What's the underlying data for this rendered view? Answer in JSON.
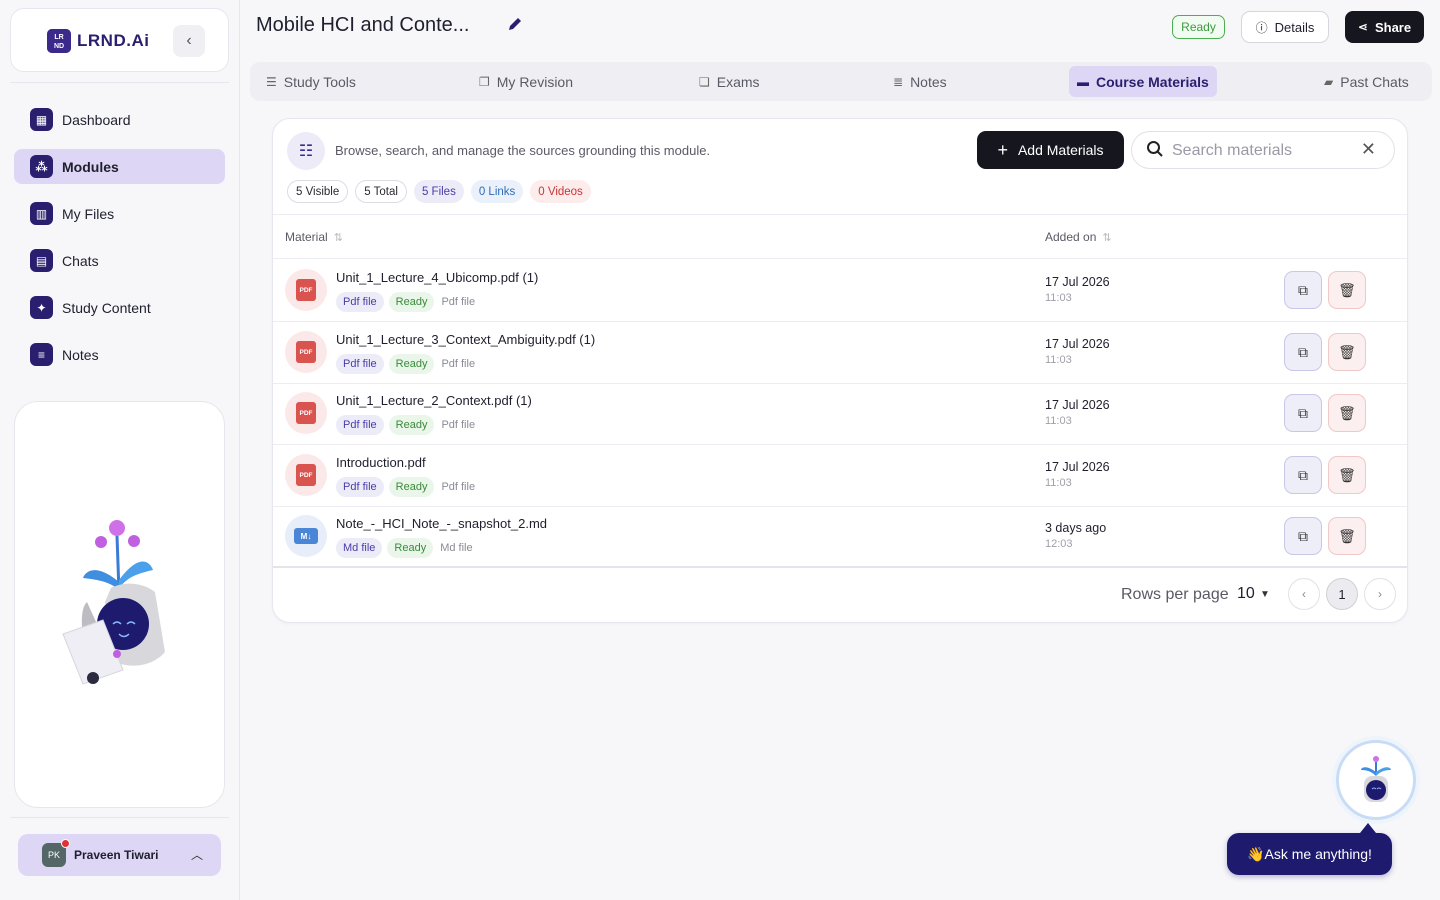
{
  "brand": {
    "logo_mark": "LR ND",
    "name": "LRND.Ai"
  },
  "sidebar": {
    "collapse_icon": "chevron-left-icon",
    "items": [
      {
        "label": "Dashboard",
        "icon": "dashboard-icon",
        "active": false
      },
      {
        "label": "Modules",
        "icon": "modules-icon",
        "active": true
      },
      {
        "label": "My Files",
        "icon": "files-icon",
        "active": false
      },
      {
        "label": "Chats",
        "icon": "chat-icon",
        "active": false
      },
      {
        "label": "Study Content",
        "icon": "sparkle-icon",
        "active": false
      },
      {
        "label": "Notes",
        "icon": "notes-icon",
        "active": false
      }
    ],
    "user": {
      "initials": "PK",
      "name": "Praveen Tiwari"
    }
  },
  "header": {
    "title": "Mobile HCI and Conte...",
    "status": "Ready",
    "details_label": "Details",
    "share_label": "Share"
  },
  "tabs": [
    {
      "label": "Study Tools",
      "icon": "menu-icon"
    },
    {
      "label": "My Revision",
      "icon": "revision-icon"
    },
    {
      "label": "Exams",
      "icon": "exams-icon"
    },
    {
      "label": "Notes",
      "icon": "notes-icon"
    },
    {
      "label": "Course Materials",
      "icon": "folder-icon",
      "active": true
    },
    {
      "label": "Past Chats",
      "icon": "chats-icon"
    }
  ],
  "materials": {
    "description": "Browse, search, and manage the sources grounding this module.",
    "add_label": "Add Materials",
    "search_placeholder": "Search materials",
    "chips": {
      "visible": "5 Visible",
      "total": "5 Total",
      "files": "5 Files",
      "links": "0 Links",
      "videos": "0 Videos"
    },
    "columns": {
      "material": "Material",
      "added_on": "Added on"
    },
    "rows": [
      {
        "name": "Unit_1_Lecture_4_Ubicomp.pdf (1)",
        "kind": "pdf",
        "type_tag": "Pdf file",
        "status": "Ready",
        "sub": "Pdf file",
        "date": "17 Jul 2026",
        "time": "11:03"
      },
      {
        "name": "Unit_1_Lecture_3_Context_Ambiguity.pdf (1)",
        "kind": "pdf",
        "type_tag": "Pdf file",
        "status": "Ready",
        "sub": "Pdf file",
        "date": "17 Jul 2026",
        "time": "11:03"
      },
      {
        "name": "Unit_1_Lecture_2_Context.pdf (1)",
        "kind": "pdf",
        "type_tag": "Pdf file",
        "status": "Ready",
        "sub": "Pdf file",
        "date": "17 Jul 2026",
        "time": "11:03"
      },
      {
        "name": "Introduction.pdf",
        "kind": "pdf",
        "type_tag": "Pdf file",
        "status": "Ready",
        "sub": "Pdf file",
        "date": "17 Jul 2026",
        "time": "11:03"
      },
      {
        "name": "Note_-_HCI_Note_-_snapshot_2.md",
        "kind": "md",
        "type_tag": "Md file",
        "status": "Ready",
        "sub": "Md file",
        "date": "3 days ago",
        "time": "12:03"
      }
    ],
    "pagination": {
      "rows_per_page_label": "Rows per page",
      "rows_per_page": "10",
      "current_page": "1"
    }
  },
  "assistant": {
    "prompt": "👋Ask me anything!"
  },
  "colors": {
    "accent": "#2a1f6e",
    "active_bg": "#ddd6f5",
    "ready": "#4caf50",
    "danger": "#d9534f"
  }
}
